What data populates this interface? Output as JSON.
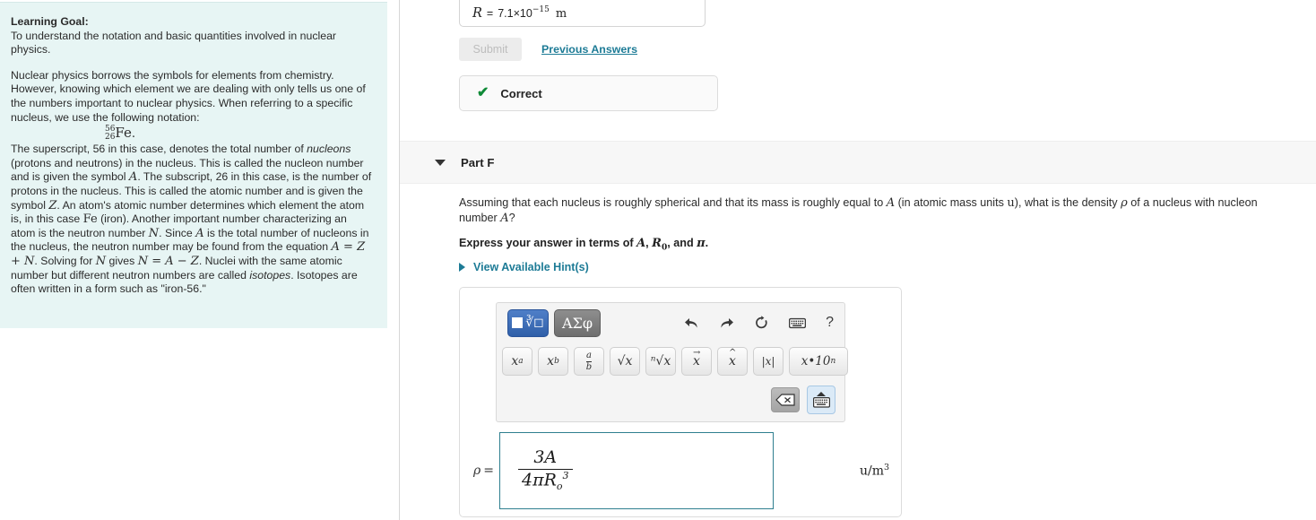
{
  "sidebar": {
    "learning_goal_label": "Learning Goal:",
    "learning_goal_text": "To understand the notation and basic quantities involved in nuclear physics.",
    "paragraph1": "Nuclear physics borrows the symbols for elements from chemistry. However, knowing which element we are dealing with only tells us one of the numbers important to nuclear physics. When referring to a specific nucleus, we use the following notation:",
    "nuclide": {
      "mass_number": "56",
      "atomic_number": "26",
      "symbol": "Fe",
      "period": "."
    },
    "paragraph2_parts": {
      "t1": "The superscript, 56 in this case, denotes the total number of ",
      "i1": "nucleons",
      "t2": " (protons and neutrons) in the nucleus. This is called the nucleon number and is given the symbol ",
      "m1": "A",
      "t3": ". The subscript, 26 in this case, is the number of protons in the nucleus. This is called the atomic number and is given the symbol ",
      "m2": "Z",
      "t4": ". An atom's atomic number determines which element the atom is, in this case ",
      "m3": "Fe",
      "t5": " (iron). Another important number characterizing an atom is the neutron number ",
      "m4": "N",
      "t6": ". Since ",
      "m5": "A",
      "t7": " is the total number of nucleons in the nucleus, the neutron number may be found from the equation ",
      "m6": "A = Z + N",
      "t8": ". Solving for ",
      "m7": "N",
      "t9": " gives ",
      "m8": "N = A − Z",
      "t10": ". Nuclei with the same atomic number but different neutron numbers are called ",
      "i2": "isotopes",
      "t11": ". Isotopes are often written in a form such as \"iron-56.\""
    }
  },
  "previous_part": {
    "answer_variable": "R",
    "equals": "=",
    "answer_value": "7.1×10",
    "answer_exponent": "−15",
    "answer_unit": "m",
    "submit_label": "Submit",
    "previous_answers_label": "Previous Answers",
    "status_icon": "check-icon",
    "status_text": "Correct"
  },
  "part": {
    "label": "Part F",
    "caret_icon": "chevron-down-icon",
    "question_parts": {
      "t1": "Assuming that each nucleus is roughly spherical and that its mass is roughly equal to ",
      "m1": "A",
      "t2": " (in atomic mass units ",
      "m2": "u",
      "t3": "), what is the density ",
      "m3": "ρ",
      "t4": " of a nucleus with nucleon number ",
      "m4": "A",
      "t5": "?"
    },
    "express_parts": {
      "t1": "Express your answer in terms of ",
      "m1": "A",
      "t2": ", ",
      "m2": "R",
      "sub2": "0",
      "t3": ", and ",
      "m3": "π",
      "t4": "."
    },
    "hint_label": "View Available Hint(s)",
    "hint_caret_icon": "chevron-right-icon"
  },
  "math_toolbar": {
    "mode_template_label": "template-mode-icon",
    "mode_greek_label": "ΑΣφ",
    "undo_icon": "undo-arrow-icon",
    "redo_icon": "redo-arrow-icon",
    "reset_icon": "refresh-icon",
    "keyboard_icon": "keyboard-icon",
    "help_label": "?",
    "keys": [
      {
        "name": "superscript-key",
        "base": "x",
        "sup": "a"
      },
      {
        "name": "subscript-key",
        "base": "x",
        "sub": "b"
      },
      {
        "name": "fraction-key",
        "num": "a",
        "den": "b"
      },
      {
        "name": "sqrt-key",
        "label": "√x"
      },
      {
        "name": "nth-root-key",
        "label": "ⁿ√x"
      },
      {
        "name": "vector-key",
        "base": "x",
        "over": "→"
      },
      {
        "name": "hat-key",
        "base": "x",
        "over": "^"
      },
      {
        "name": "absolute-value-key",
        "label": "|x|"
      },
      {
        "name": "scientific-notation-key",
        "label": "x•10",
        "sup": "n"
      }
    ],
    "backspace_icon": "backspace-icon",
    "keyboard_toggle_icon": "keyboard-up-icon"
  },
  "answer": {
    "variable": "ρ",
    "equals": "=",
    "numerator": "3A",
    "denominator_coeff": "4πR",
    "denominator_sub": "o",
    "denominator_sup": "3",
    "units": "u/m",
    "units_sup": "3"
  },
  "colors": {
    "sidebar_bg": "#e7f5f4",
    "link": "#1d7b96",
    "correct_green": "#0f8a37",
    "field_border": "#2f7f8f",
    "toolbar_active_blue": "#2f5fa8"
  }
}
